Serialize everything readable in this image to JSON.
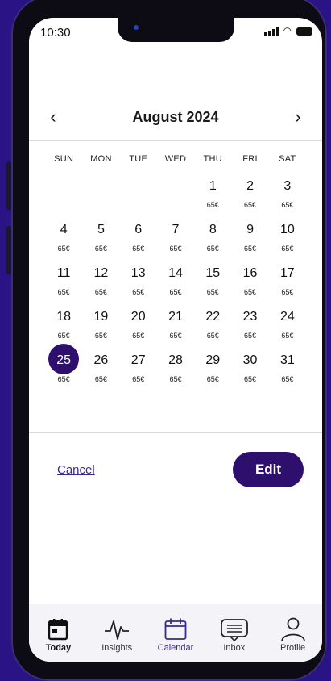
{
  "status": {
    "time": "10:30"
  },
  "calendar": {
    "month": "August 2024",
    "prev": "‹",
    "next": "›",
    "weekdays": [
      "SUN",
      "MON",
      "TUE",
      "WED",
      "THU",
      "FRI",
      "SAT"
    ],
    "price": "65€",
    "first_weekday": 4,
    "days_in_month": 31,
    "selected_day": 25
  },
  "actions": {
    "cancel": "Cancel",
    "edit": "Edit"
  },
  "tabs": [
    {
      "label": "Today",
      "icon": "calendar-day-icon"
    },
    {
      "label": "Insights",
      "icon": "pulse-icon"
    },
    {
      "label": "Calendar",
      "icon": "calendar-icon"
    },
    {
      "label": "Inbox",
      "icon": "inbox-icon"
    },
    {
      "label": "Profile",
      "icon": "profile-icon"
    }
  ],
  "colors": {
    "accent": "#2f0f6e",
    "background": "#2a1385"
  }
}
